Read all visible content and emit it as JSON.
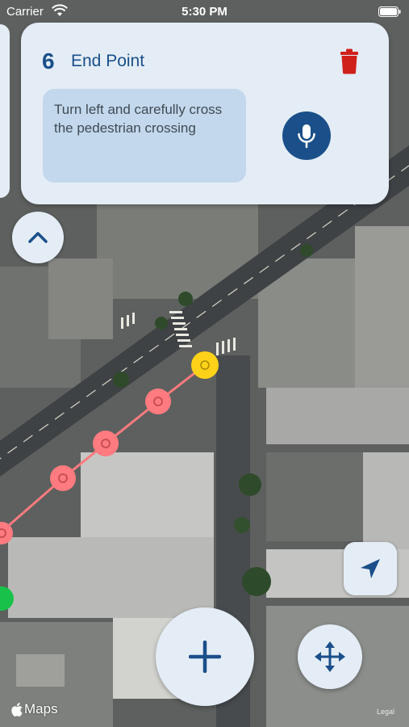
{
  "status_bar": {
    "carrier": "Carrier",
    "time": "5:30 PM"
  },
  "card": {
    "step_number": "6",
    "title": "End Point",
    "instruction": "Turn left and carefully cross the pedestrian crossing"
  },
  "map": {
    "attribution": "Maps",
    "legal": "Legal"
  },
  "icons": {
    "trash": "trash-icon",
    "mic": "microphone-icon",
    "collapse": "chevron-up-icon",
    "location": "location-arrow-icon",
    "add": "plus-icon",
    "move": "move-arrows-icon"
  },
  "colors": {
    "accent": "#1a4f8a",
    "card_bg": "#e4edf6",
    "instruction_bg": "#c3d8ec",
    "delete": "#d0201a",
    "route": "#ff7b80",
    "end_point": "#ffd21a",
    "start_point": "#18c24a"
  }
}
